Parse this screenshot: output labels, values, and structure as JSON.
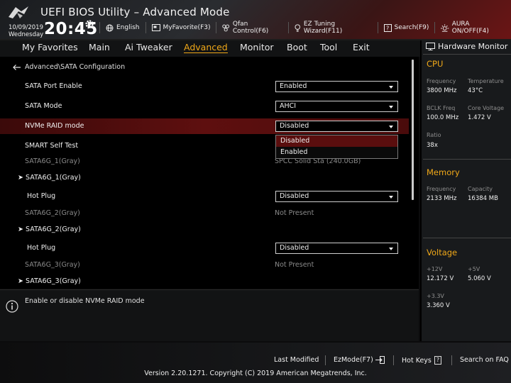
{
  "header": {
    "title": "UEFI BIOS Utility – Advanced Mode",
    "date": "10/09/2019",
    "weekday": "Wednesday",
    "time": "20:45",
    "tools": [
      {
        "label": "English",
        "icon": "globe-icon"
      },
      {
        "label": "MyFavorite(F3)",
        "icon": "favorite-icon"
      },
      {
        "label": "Qfan Control(F6)",
        "icon": "fan-icon"
      },
      {
        "label": "EZ Tuning Wizard(F11)",
        "icon": "bulb-icon"
      },
      {
        "label": "Search(F9)",
        "icon": "search-help-icon"
      },
      {
        "label": "AURA ON/OFF(F4)",
        "icon": "aura-icon"
      }
    ]
  },
  "nav": {
    "tabs": [
      "My Favorites",
      "Main",
      "Ai Tweaker",
      "Advanced",
      "Monitor",
      "Boot",
      "Tool",
      "Exit"
    ],
    "active": "Advanced"
  },
  "breadcrumb": "Advanced\\SATA Configuration",
  "settings": [
    {
      "label": "SATA Port Enable",
      "value": "Enabled"
    },
    {
      "label": "SATA Mode",
      "value": "AHCI"
    },
    {
      "label": "NVMe RAID mode",
      "value": "Disabled"
    },
    {
      "label": "SMART Self Test"
    },
    {
      "label": "SATA6G_1(Gray)",
      "value": "SPCC Solid Sta (240.0GB)"
    },
    {
      "label": "SATA6G_1(Gray)"
    },
    {
      "label": "Hot Plug",
      "value": "Disabled"
    },
    {
      "label": "SATA6G_2(Gray)",
      "value": "Not Present"
    },
    {
      "label": "SATA6G_2(Gray)"
    },
    {
      "label": "Hot Plug",
      "value": "Disabled"
    },
    {
      "label": "SATA6G_3(Gray)",
      "value": "Not Present"
    },
    {
      "label": "SATA6G_3(Gray)"
    }
  ],
  "popup": {
    "options": [
      "Disabled",
      "Enabled"
    ],
    "selected": "Disabled"
  },
  "help": "Enable or disable NVMe RAID mode",
  "hardware_monitor": {
    "title": "Hardware Monitor",
    "cpu": {
      "section": "CPU",
      "frequency_label": "Frequency",
      "frequency": "3800 MHz",
      "temperature_label": "Temperature",
      "temperature": "43°C",
      "bclk_label": "BCLK Freq",
      "bclk": "100.0 MHz",
      "core_voltage_label": "Core Voltage",
      "core_voltage": "1.472 V",
      "ratio_label": "Ratio",
      "ratio": "38x"
    },
    "memory": {
      "section": "Memory",
      "frequency_label": "Frequency",
      "frequency": "2133 MHz",
      "capacity_label": "Capacity",
      "capacity": "16384 MB"
    },
    "voltage": {
      "section": "Voltage",
      "v12_label": "+12V",
      "v12": "12.172 V",
      "v5_label": "+5V",
      "v5": "5.060 V",
      "v33_label": "+3.3V",
      "v33": "3.360 V"
    }
  },
  "footer": {
    "last_modified": "Last Modified",
    "ezmode": "EzMode(F7)",
    "hot_keys": "Hot Keys",
    "hot_keys_key": "?",
    "search_faq": "Search on FAQ",
    "version": "Version 2.20.1271. Copyright (C) 2019 American Megatrends, Inc."
  },
  "colors": {
    "accent": "#f0a818",
    "highlight": "#5e0f0f",
    "background": "#000000"
  }
}
